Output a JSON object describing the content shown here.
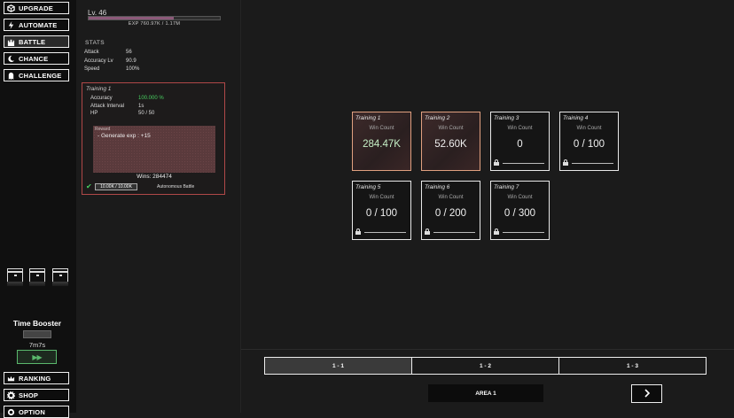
{
  "menu": [
    {
      "label": "UPGRADE",
      "icon": "cube-icon",
      "active": false
    },
    {
      "label": "AUTOMATE",
      "icon": "lightning-icon",
      "active": false
    },
    {
      "label": "BATTLE",
      "icon": "castle-icon",
      "active": true
    },
    {
      "label": "CHANCE",
      "icon": "moon-icon",
      "active": false
    },
    {
      "label": "CHALLENGE",
      "icon": "ghost-icon",
      "active": false
    }
  ],
  "bottom_menu": [
    {
      "label": "RANKING",
      "icon": "crown-icon"
    },
    {
      "label": "SHOP",
      "icon": "gear-icon"
    },
    {
      "label": "OPTION",
      "icon": "gear-icon"
    }
  ],
  "player": {
    "level": "Lv. 46",
    "exp_text": "EXP 760.97K / 1.17M",
    "exp_fraction": 0.65
  },
  "stats": {
    "heading": "STATS",
    "rows": [
      {
        "label": "Attack",
        "value": "56"
      },
      {
        "label": "Accuracy Lv",
        "value": "90.9"
      },
      {
        "label": "Speed",
        "value": "100%"
      }
    ]
  },
  "detail": {
    "title": "Training 1",
    "rows": [
      {
        "label": "Accuracy",
        "value": "100.000 %"
      },
      {
        "label": "Attack Interval",
        "value": "1s"
      },
      {
        "label": "HP",
        "value": "50 / 50"
      }
    ],
    "reward_label": "Reward",
    "reward_text": "- Generate exp : +15",
    "wins": "Wins: 284474",
    "auto_progress": "10.00K / 10.00K",
    "auto_label": "Autonomous Battle"
  },
  "time_booster": {
    "title": "Time Booster",
    "time": "7m7s",
    "button_glyph": "▶▶"
  },
  "win_count_label": "Win Count",
  "trainings": [
    {
      "name": "Training 1",
      "value": "284.47K",
      "state": "active"
    },
    {
      "name": "Training 2",
      "value": "52.60K",
      "state": "active"
    },
    {
      "name": "Training 3",
      "value": "0",
      "state": "locked"
    },
    {
      "name": "Training 4",
      "value": "0 / 100",
      "state": "locked"
    },
    {
      "name": "Training 5",
      "value": "0 / 100",
      "state": "locked"
    },
    {
      "name": "Training 6",
      "value": "0 / 200",
      "state": "locked"
    },
    {
      "name": "Training 7",
      "value": "0 / 300",
      "state": "locked"
    }
  ],
  "area_tabs": [
    {
      "label": "1 - 1",
      "selected": true
    },
    {
      "label": "1 - 2",
      "selected": false
    },
    {
      "label": "1 - 3",
      "selected": false
    }
  ],
  "area_label": "AREA 1",
  "colors": {
    "active_border": "#e0a080",
    "detail_border": "#b04848",
    "green": "#48d060",
    "exp_fill": "#8d5a7a"
  }
}
